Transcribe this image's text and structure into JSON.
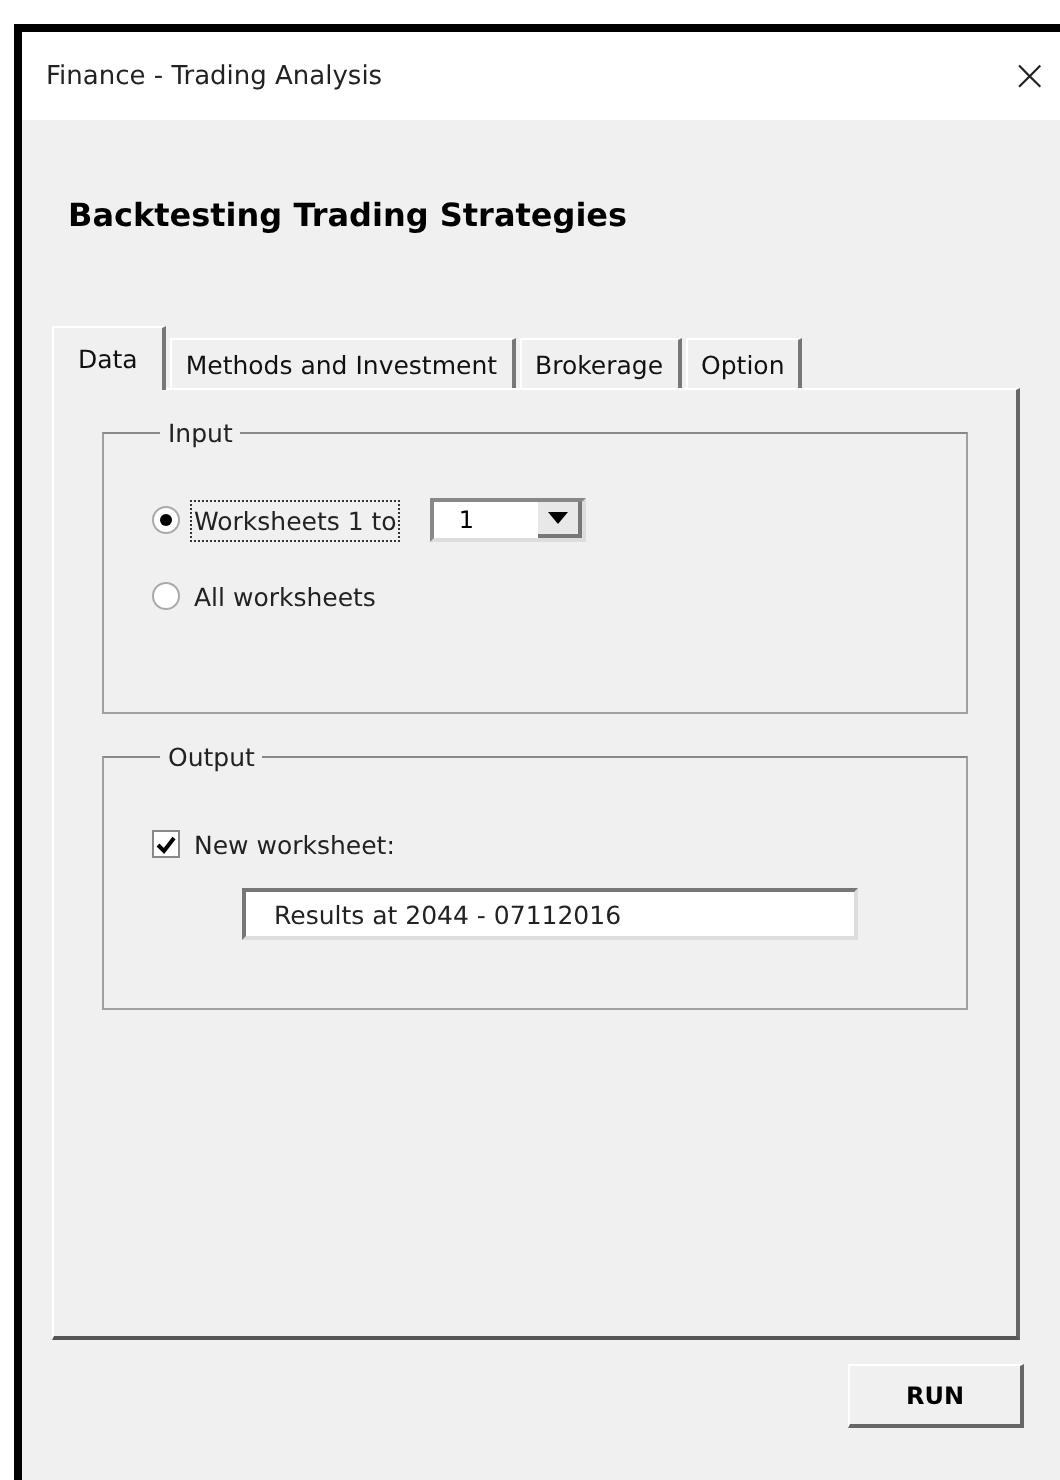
{
  "window": {
    "title": "Finance - Trading Analysis",
    "close": "×"
  },
  "heading": "Backtesting Trading Strategies",
  "tabs": [
    {
      "label": "Data",
      "selected": true
    },
    {
      "label": "Methods and Investment",
      "selected": false
    },
    {
      "label": "Brokerage",
      "selected": false
    },
    {
      "label": "Option",
      "selected": false
    }
  ],
  "input_group": {
    "legend": "Input",
    "options": [
      {
        "label": "Worksheets 1 to",
        "selected": true,
        "focused": true
      },
      {
        "label": "All worksheets",
        "selected": false,
        "focused": false
      }
    ],
    "dropdown": {
      "value": "1"
    }
  },
  "output_group": {
    "legend": "Output",
    "checkbox": {
      "label": "New worksheet:",
      "checked": true
    },
    "field": {
      "value": "Results at 2044 - 07112016"
    }
  },
  "buttons": [
    {
      "label": "RUN"
    }
  ]
}
